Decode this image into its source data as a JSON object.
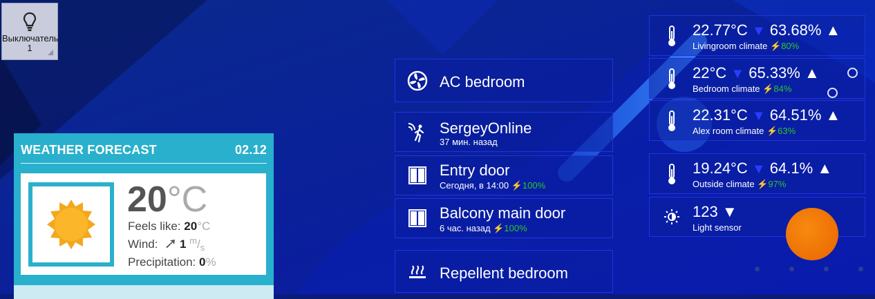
{
  "switch": {
    "label": "Выключатель 1",
    "icon": "lightbulb-icon"
  },
  "weather": {
    "title": "WEATHER FORECAST",
    "date": "02.12",
    "temp_value": "20",
    "temp_unit": "°C",
    "feels_label": "Feels like:",
    "feels_value": "20",
    "feels_unit": "°C",
    "wind_label": "Wind:",
    "wind_value": "1",
    "wind_unit_top": "m",
    "wind_unit_bottom": "s",
    "precip_label": "Precipitation:",
    "precip_value": "0",
    "precip_unit": "%",
    "icon": "sun-icon"
  },
  "devices": [
    {
      "name": "AC bedroom",
      "icon": "fan-icon"
    },
    {
      "name": "SergeyOnline",
      "sub": "37 мин. назад",
      "icon": "motion-sensor-icon"
    },
    {
      "name": "Entry door",
      "sub": "Сегодня, в 14:00",
      "battery": "100%",
      "icon": "door-icon"
    },
    {
      "name": "Balcony main door",
      "sub": "6 час. назад",
      "battery": "100%",
      "icon": "door-icon"
    },
    {
      "name": "Repellent bedroom",
      "icon": "heating-icon"
    }
  ],
  "climate": [
    {
      "temp": "22.77°C",
      "hum": "63.68%",
      "label": "Livingroom climate",
      "battery": "80%"
    },
    {
      "temp": "22°C",
      "hum": "65.33%",
      "label": "Bedroom climate",
      "battery": "84%"
    },
    {
      "temp": "22.31°C",
      "hum": "64.51%",
      "label": "Alex room climate",
      "battery": "63%"
    },
    {
      "temp": "19.24°C",
      "hum": "64.1%",
      "label": "Outside climate",
      "battery": "97%"
    }
  ],
  "light_sensor": {
    "value": "123",
    "label": "Light sensor",
    "icon": "brightness-icon"
  },
  "colors": {
    "accent_green": "#2ec52e",
    "down_arrow": "#2a3dff",
    "weather_teal": "#29b0cc",
    "orb": "#f07808"
  }
}
